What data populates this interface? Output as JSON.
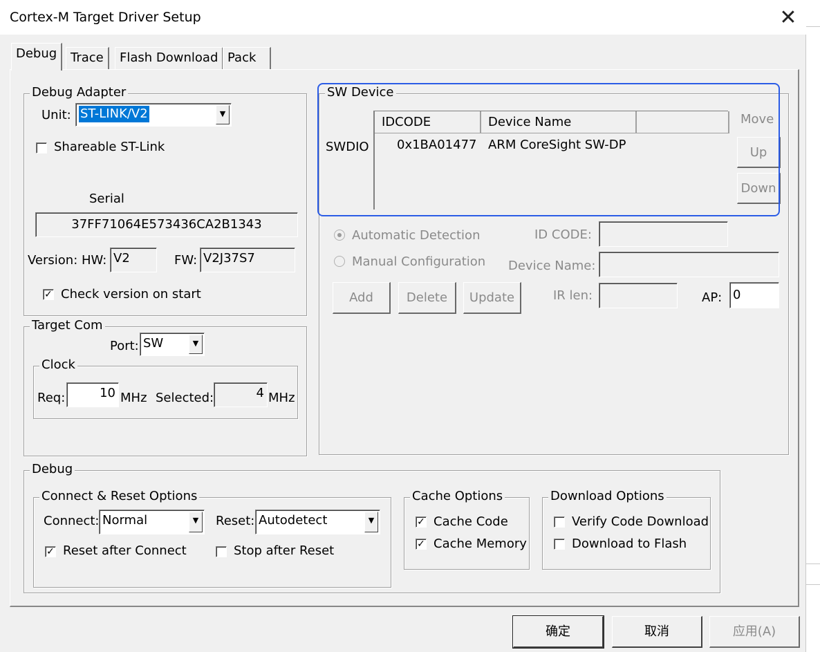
{
  "window": {
    "title": "Cortex-M Target Driver Setup",
    "close_glyph": "✕"
  },
  "tabs": [
    {
      "label": "Debug",
      "active": true
    },
    {
      "label": "Trace",
      "active": false
    },
    {
      "label": "Flash Download",
      "active": false
    },
    {
      "label": "Pack",
      "active": false
    }
  ],
  "debug_adapter": {
    "legend": "Debug Adapter",
    "unit_label": "Unit:",
    "unit_value": "ST-LINK/V2",
    "shareable_label": "Shareable ST-Link",
    "shareable_checked": false,
    "serial_label": "Serial",
    "serial_value": "37FF71064E573436CA2B1343",
    "version_label": "Version: HW:",
    "hw_value": "V2",
    "fw_label": "FW:",
    "fw_value": "V2J37S7",
    "check_version_label": "Check version on start",
    "check_version_checked": true
  },
  "target_com": {
    "legend": "Target Com",
    "port_label": "Port:",
    "port_value": "SW",
    "clock": {
      "legend": "Clock",
      "req_label": "Req:",
      "req_value": "10",
      "mhz1": "MHz",
      "selected_label": "Selected:",
      "selected_value": "4",
      "mhz2": "MHz"
    }
  },
  "sw_device": {
    "legend": "SW Device",
    "row_label": "SWDIO",
    "columns": [
      "IDCODE",
      "Device Name",
      ""
    ],
    "rows": [
      {
        "idcode": "0x1BA01477",
        "device_name": "ARM CoreSight SW-DP"
      }
    ],
    "move_label": "Move",
    "up_label": "Up",
    "down_label": "Down",
    "auto_detect_label": "Automatic Detection",
    "auto_detect_selected": true,
    "manual_config_label": "Manual Configuration",
    "id_code_label": "ID CODE:",
    "device_name_label": "Device Name:",
    "add_label": "Add",
    "delete_label": "Delete",
    "update_label": "Update",
    "ir_len_label": "IR len:",
    "ap_label": "AP:",
    "ap_value": "0",
    "highlight_color": "#2b5ce6"
  },
  "debug": {
    "legend": "Debug",
    "connect_reset": {
      "legend": "Connect & Reset Options",
      "connect_label": "Connect:",
      "connect_value": "Normal",
      "reset_label": "Reset:",
      "reset_value": "Autodetect",
      "reset_after_connect_label": "Reset after Connect",
      "reset_after_connect_checked": true,
      "stop_after_reset_label": "Stop after Reset",
      "stop_after_reset_checked": false
    },
    "cache": {
      "legend": "Cache Options",
      "cache_code_label": "Cache Code",
      "cache_code_checked": true,
      "cache_memory_label": "Cache Memory",
      "cache_memory_checked": true
    },
    "download": {
      "legend": "Download Options",
      "verify_label": "Verify Code Download",
      "verify_checked": false,
      "download_flash_label": "Download to Flash",
      "download_flash_checked": false
    }
  },
  "footer": {
    "ok_label": "确定",
    "cancel_label": "取消",
    "apply_label": "应用(A)"
  },
  "colors": {
    "dialog_bg": "#f0f0f0",
    "selection": "#0078d7",
    "disabled_text": "#8a8a8a"
  }
}
